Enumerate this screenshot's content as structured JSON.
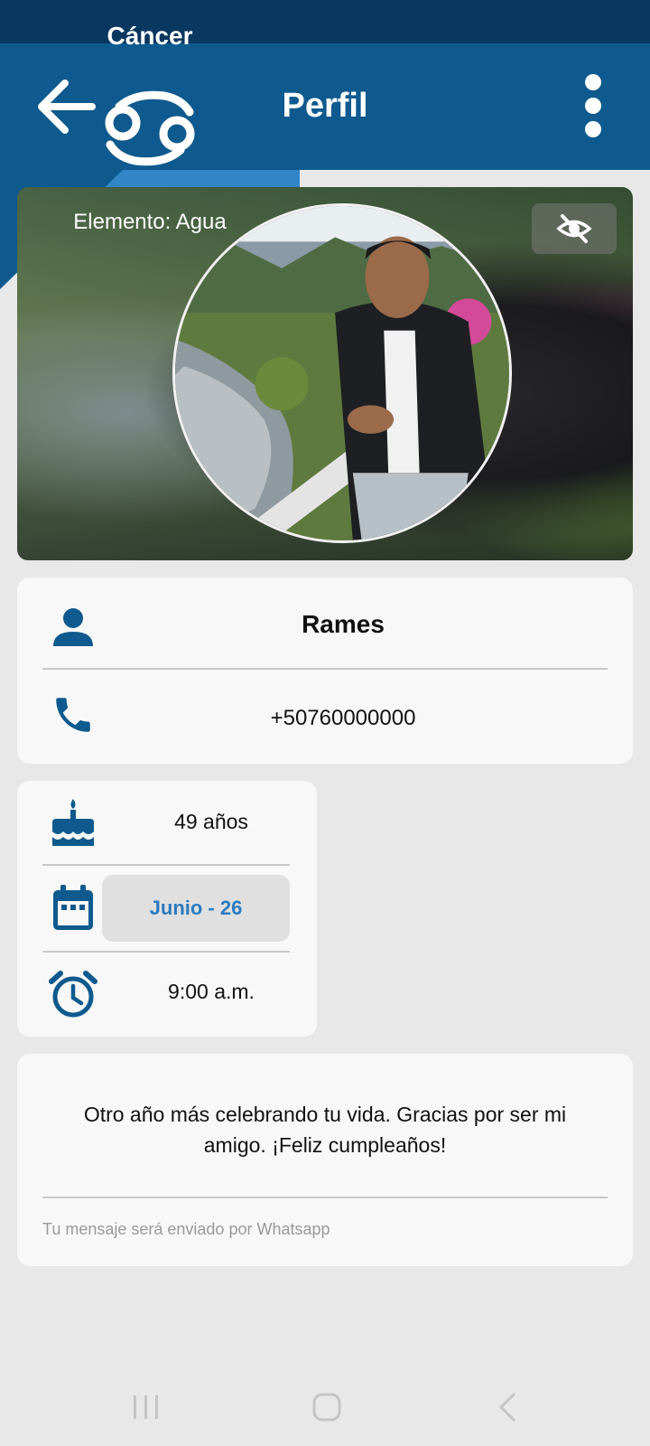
{
  "header": {
    "title": "Perfil",
    "back_icon": "arrow-left-icon",
    "menu_icon": "more-vertical-icon"
  },
  "colors": {
    "primary": "#0e5a8e",
    "status_bar": "#08375f",
    "zodiac_card": "#3285c6",
    "accent_text": "#2b7bbf",
    "icon": "#0e5a8e"
  },
  "photo": {
    "hide_icon": "eye-off-icon"
  },
  "contact": {
    "name": "Rames",
    "phone": "+50760000000",
    "name_icon": "person-icon",
    "phone_icon": "phone-icon"
  },
  "birthday": {
    "age": "49 años",
    "date": "Junio - 26",
    "time": "9:00 a.m.",
    "age_icon": "cake-icon",
    "date_icon": "calendar-icon",
    "time_icon": "alarm-clock-icon"
  },
  "zodiac": {
    "sign": "Cáncer",
    "element": "Elemento: Agua",
    "symbol_icon": "cancer-zodiac-icon"
  },
  "message": {
    "text": "Otro año más celebrando tu vida. Gracias por ser mi amigo. ¡Feliz cumpleaños!",
    "hint": "Tu mensaje será enviado por Whatsapp"
  },
  "system_nav": {
    "recents_icon": "recents-icon",
    "home_icon": "home-icon",
    "back_icon": "back-chevron-icon"
  }
}
